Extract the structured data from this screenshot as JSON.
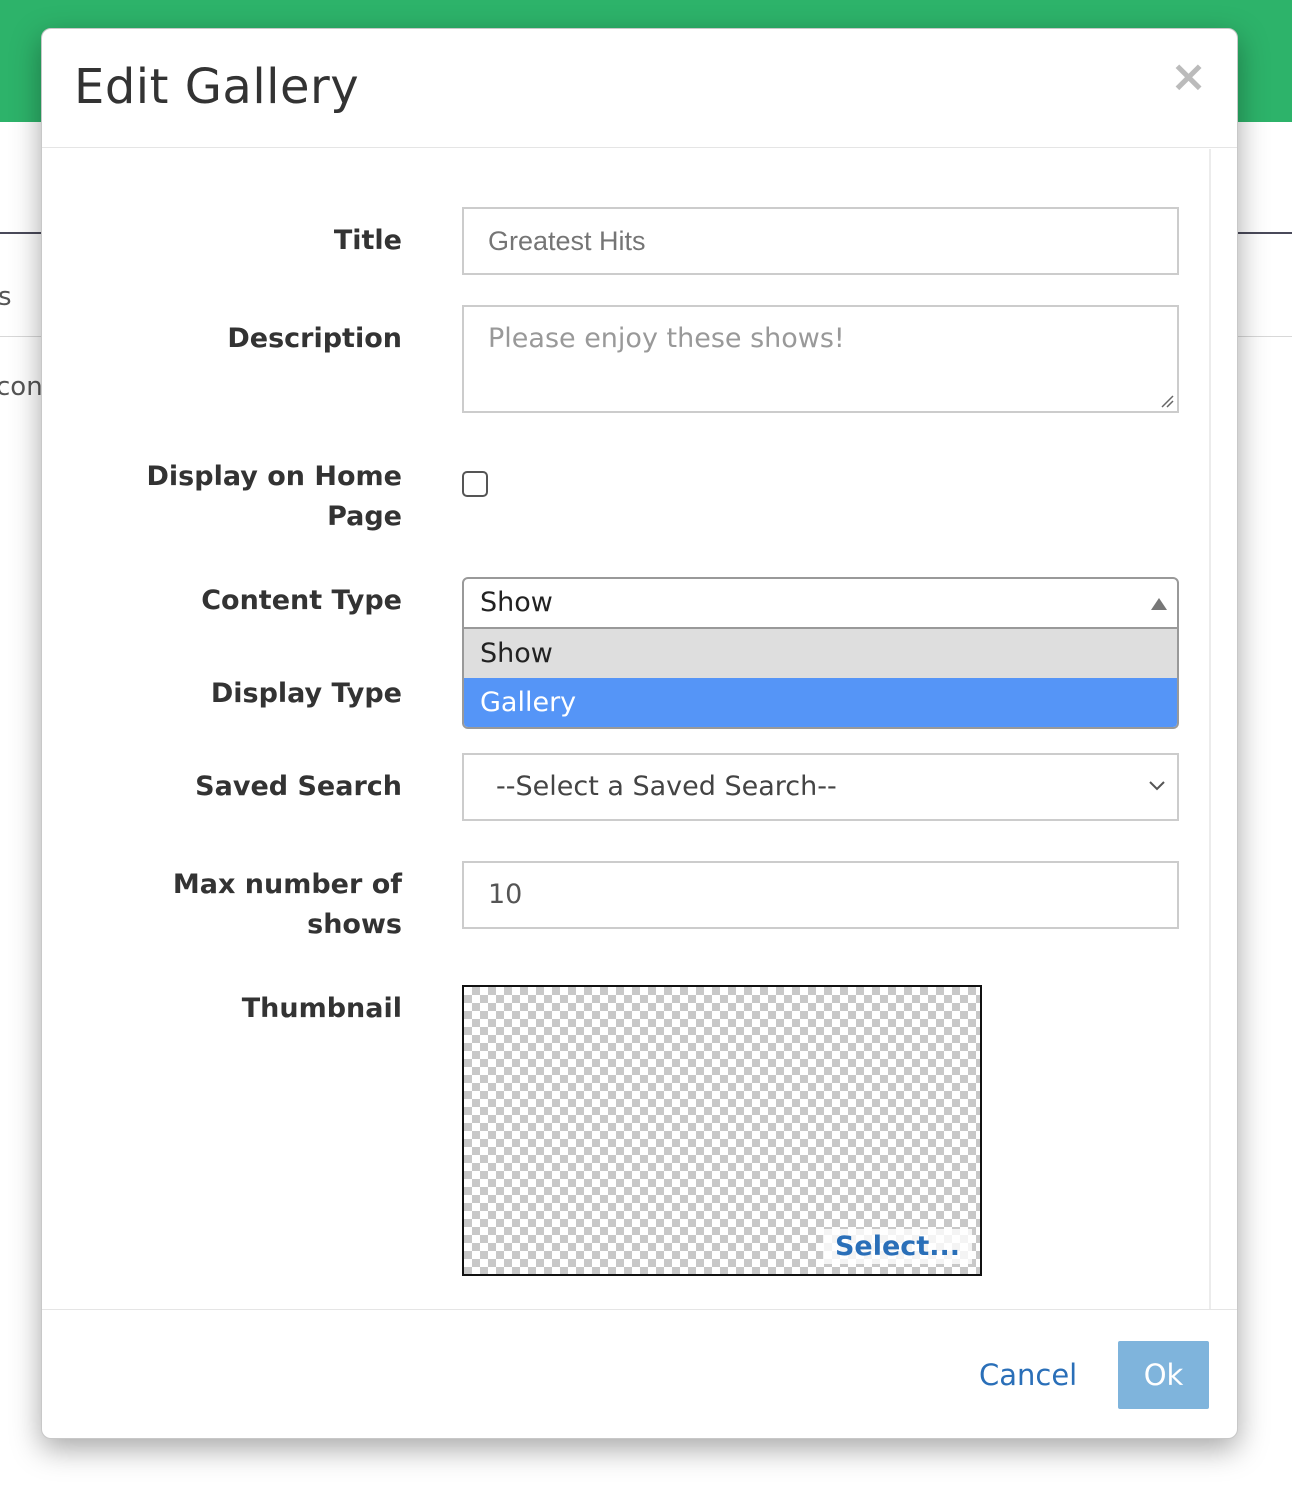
{
  "background": {
    "fragment_1": "s",
    "fragment_2": "conf"
  },
  "modal": {
    "title": "Edit Gallery",
    "close_label": "×"
  },
  "form": {
    "title": {
      "label": "Title",
      "placeholder": "Greatest Hits"
    },
    "description": {
      "label": "Description",
      "placeholder": "Please enjoy these shows!"
    },
    "display_on_home": {
      "label_line1": "Display on Home",
      "label_line2": "Page",
      "checked": false
    },
    "content_type": {
      "label": "Content Type",
      "value": "Show",
      "options": [
        "Show",
        "Gallery"
      ],
      "highlighted": "Gallery"
    },
    "display_type": {
      "label": "Display Type"
    },
    "saved_search": {
      "label": "Saved Search",
      "value": "--Select a Saved Search--"
    },
    "max_shows": {
      "label_line1": "Max number of",
      "label_line2": "shows",
      "value": "10"
    },
    "thumbnail": {
      "label": "Thumbnail",
      "select_label": "Select..."
    }
  },
  "footer": {
    "cancel_label": "Cancel",
    "ok_label": "Ok"
  },
  "colors": {
    "topbar": "#2db36a",
    "link": "#2a6fb8",
    "ok_button": "#7fb4dc",
    "option_highlight": "#5595f7"
  }
}
